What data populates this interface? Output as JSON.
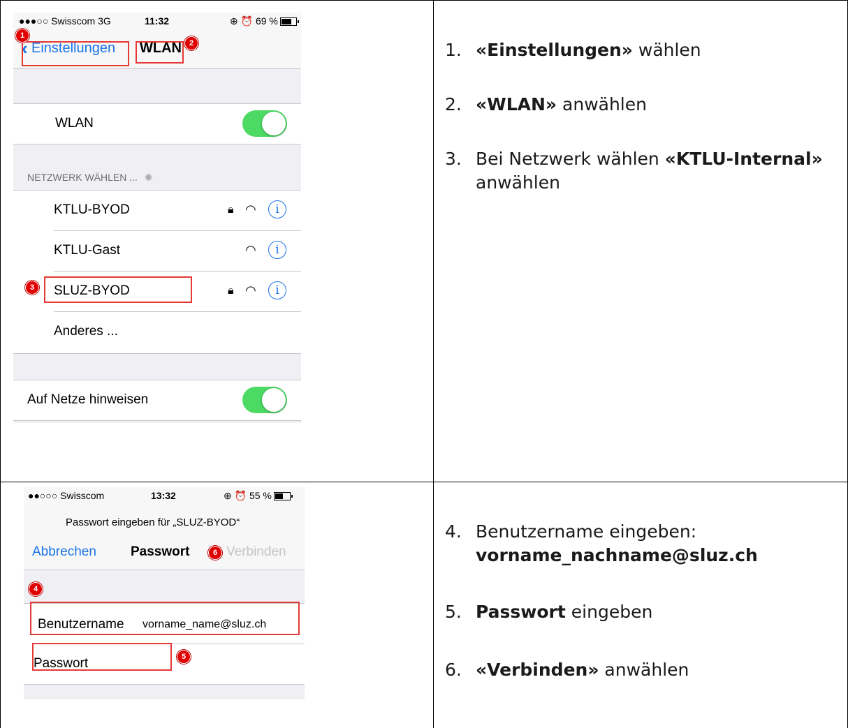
{
  "top_phone": {
    "status": {
      "carrier": "●●●○○ Swisscom 3G",
      "time": "11:32",
      "right": "⊕ ⏰ 69 %"
    },
    "back_label": "Einstellungen",
    "nav_title": "WLAN",
    "wlan_row": "WLAN",
    "section_header": "NETZWERK WÄHLEN ...",
    "networks": [
      {
        "name": "KTLU-BYOD"
      },
      {
        "name": "KTLU-Gast"
      },
      {
        "name": "SLUZ-BYOD"
      },
      {
        "name": "Anderes ..."
      }
    ],
    "ask_to_join": "Auf Netze hinweisen",
    "badges": [
      "1",
      "2",
      "3"
    ]
  },
  "bottom_phone": {
    "status": {
      "carrier": "●●○○○ Swisscom",
      "time": "13:32",
      "right": "⊕ ⏰ 55 %"
    },
    "prompt": "Passwort eingeben für „SLUZ-BYOD“",
    "cancel": "Abbrechen",
    "title": "Passwort",
    "connect": "Verbinden",
    "username_label": "Benutzername",
    "username_value": "vorname_name@sluz.ch",
    "password_label": "Passwort",
    "badges": [
      "4",
      "5",
      "6"
    ]
  },
  "steps_top": [
    {
      "num": "1.",
      "pre": "",
      "bold": "«Einstellungen»",
      "post": " wählen"
    },
    {
      "num": "2.",
      "pre": "",
      "bold": "«WLAN»",
      "post": " anwählen"
    },
    {
      "num": "3.",
      "pre": "Bei Netzwerk wählen ",
      "bold": "«KTLU-Internal»",
      "post": " anwählen"
    }
  ],
  "steps_bottom": [
    {
      "num": "4.",
      "pre": "Benutzername eingeben: ",
      "bold": "vorname_nachname@sluz.ch",
      "post": ""
    },
    {
      "num": "5.",
      "pre": "",
      "bold": "Passwort",
      "post": " eingeben"
    },
    {
      "num": "6.",
      "pre": "",
      "bold": "«Verbinden»",
      "post": " anwählen"
    }
  ],
  "colors": {
    "toggle_on": "#4cd964",
    "ios_blue": "#1a73e8",
    "marker_red": "#e53935",
    "badge_red": "#e00000"
  }
}
